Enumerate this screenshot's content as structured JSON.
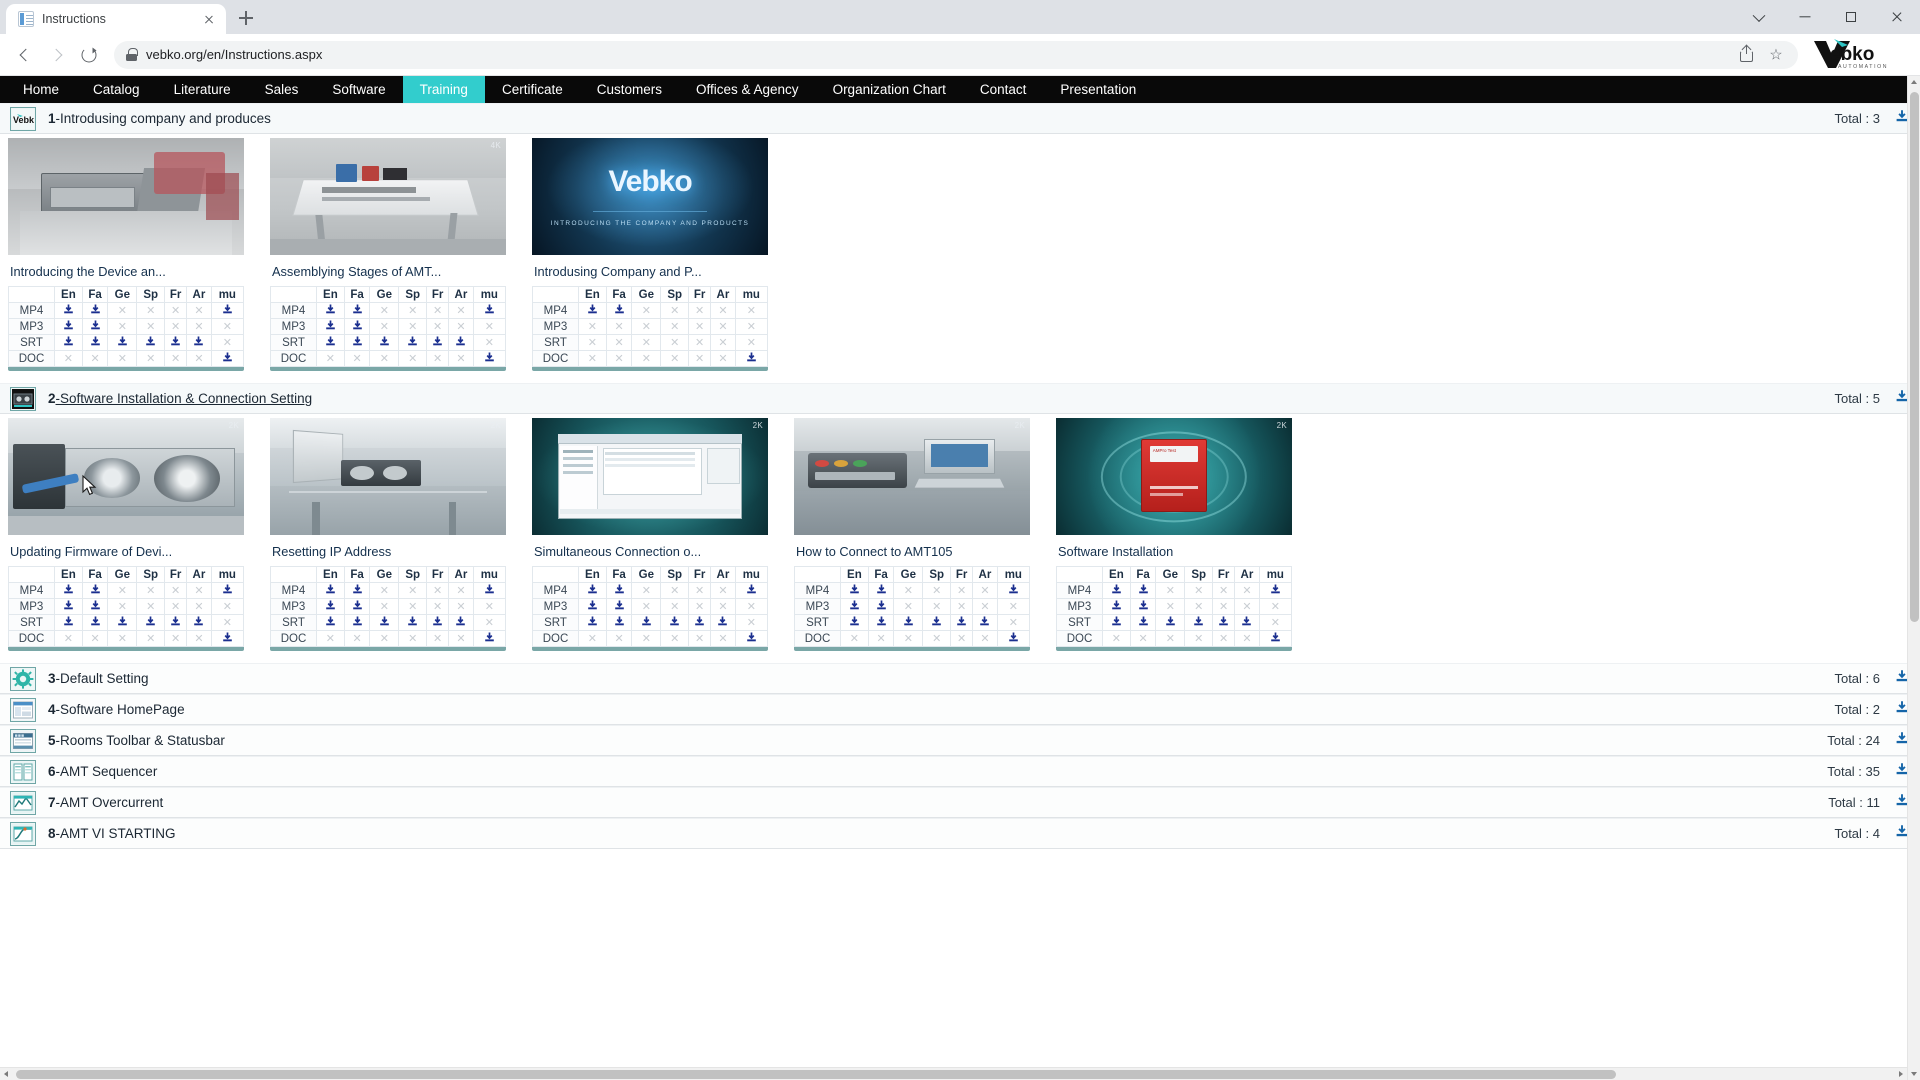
{
  "browser": {
    "tab_title": "Instructions",
    "url": "vebko.org/en/Instructions.aspx",
    "new_tab_label": "+",
    "logo_text": "Vebko",
    "logo_sub": "AUTOMATION"
  },
  "navbar": {
    "items": [
      {
        "label": "Home",
        "active": false
      },
      {
        "label": "Catalog",
        "active": false
      },
      {
        "label": "Literature",
        "active": false
      },
      {
        "label": "Sales",
        "active": false
      },
      {
        "label": "Software",
        "active": false
      },
      {
        "label": "Training",
        "active": true
      },
      {
        "label": "Certificate",
        "active": false
      },
      {
        "label": "Customers",
        "active": false
      },
      {
        "label": "Offices & Agency",
        "active": false
      },
      {
        "label": "Organization Chart",
        "active": false
      },
      {
        "label": "Contact",
        "active": false
      },
      {
        "label": "Presentation",
        "active": false
      }
    ],
    "accent_color": "#32CDCD",
    "background_color": "#090909"
  },
  "lang_columns": [
    "En",
    "Fa",
    "Ge",
    "Sp",
    "Fr",
    "Ar",
    "mu"
  ],
  "media_rows": [
    "MP4",
    "MP3",
    "SRT",
    "DOC"
  ],
  "sections": [
    {
      "number": "1",
      "title": "-Introdusing company and produces",
      "total_label": "Total : 3",
      "expanded": true,
      "link": false,
      "icon": "vebko-logo-icon",
      "cards": [
        {
          "title": "Introducing the Device an...",
          "thumb": "workbench-case",
          "badge": "",
          "matrix": {
            "MP4": [
              1,
              1,
              0,
              0,
              0,
              0,
              1
            ],
            "MP3": [
              1,
              1,
              0,
              0,
              0,
              0,
              0
            ],
            "SRT": [
              1,
              1,
              1,
              1,
              1,
              1,
              0
            ],
            "DOC": [
              0,
              0,
              0,
              0,
              0,
              0,
              1
            ]
          }
        },
        {
          "title": "Assemblying Stages of AMT...",
          "thumb": "assembly-table",
          "badge": "4K",
          "matrix": {
            "MP4": [
              1,
              1,
              0,
              0,
              0,
              0,
              1
            ],
            "MP3": [
              1,
              1,
              0,
              0,
              0,
              0,
              0
            ],
            "SRT": [
              1,
              1,
              1,
              1,
              1,
              1,
              0
            ],
            "DOC": [
              0,
              0,
              0,
              0,
              0,
              0,
              1
            ]
          }
        },
        {
          "title": "Introdusing Company and P...",
          "thumb": "vebko-intro-video",
          "badge": "",
          "matrix": {
            "MP4": [
              1,
              1,
              0,
              0,
              0,
              0,
              0
            ],
            "MP3": [
              0,
              0,
              0,
              0,
              0,
              0,
              0
            ],
            "SRT": [
              0,
              0,
              0,
              0,
              0,
              0,
              0
            ],
            "DOC": [
              0,
              0,
              0,
              0,
              0,
              0,
              1
            ]
          }
        }
      ]
    },
    {
      "number": "2",
      "title": "-Software Installation & Connection Setting",
      "total_label": "Total : 5",
      "expanded": true,
      "link": true,
      "icon": "device-rack-icon",
      "cards": [
        {
          "title": "Updating Firmware of Devi...",
          "thumb": "firmware-device",
          "badge": "2K",
          "matrix": {
            "MP4": [
              1,
              1,
              0,
              0,
              0,
              0,
              1
            ],
            "MP3": [
              1,
              1,
              0,
              0,
              0,
              0,
              0
            ],
            "SRT": [
              1,
              1,
              1,
              1,
              1,
              1,
              0
            ],
            "DOC": [
              0,
              0,
              0,
              0,
              0,
              0,
              1
            ]
          }
        },
        {
          "title": "Resetting IP Address",
          "thumb": "ip-reset-bench",
          "badge": "2K",
          "matrix": {
            "MP4": [
              1,
              1,
              0,
              0,
              0,
              0,
              1
            ],
            "MP3": [
              1,
              1,
              0,
              0,
              0,
              0,
              0
            ],
            "SRT": [
              1,
              1,
              1,
              1,
              1,
              1,
              0
            ],
            "DOC": [
              0,
              0,
              0,
              0,
              0,
              0,
              1
            ]
          }
        },
        {
          "title": "Simultaneous Connection o...",
          "thumb": "software-window",
          "badge": "2K",
          "matrix": {
            "MP4": [
              1,
              1,
              0,
              0,
              0,
              0,
              1
            ],
            "MP3": [
              1,
              1,
              0,
              0,
              0,
              0,
              0
            ],
            "SRT": [
              1,
              1,
              1,
              1,
              1,
              1,
              0
            ],
            "DOC": [
              0,
              0,
              0,
              0,
              0,
              0,
              1
            ]
          }
        },
        {
          "title": "How to Connect to AMT105",
          "thumb": "amt105-bench",
          "badge": "2K",
          "matrix": {
            "MP4": [
              1,
              1,
              0,
              0,
              0,
              0,
              1
            ],
            "MP3": [
              1,
              1,
              0,
              0,
              0,
              0,
              0
            ],
            "SRT": [
              1,
              1,
              1,
              1,
              1,
              1,
              0
            ],
            "DOC": [
              0,
              0,
              0,
              0,
              0,
              0,
              1
            ]
          }
        },
        {
          "title": "Software Installation",
          "thumb": "installer-box",
          "badge": "2K",
          "matrix": {
            "MP4": [
              1,
              1,
              0,
              0,
              0,
              0,
              1
            ],
            "MP3": [
              1,
              1,
              0,
              0,
              0,
              0,
              0
            ],
            "SRT": [
              1,
              1,
              1,
              1,
              1,
              1,
              0
            ],
            "DOC": [
              0,
              0,
              0,
              0,
              0,
              0,
              1
            ]
          }
        }
      ]
    },
    {
      "number": "3",
      "title": "-Default Setting",
      "total_label": "Total : 6",
      "expanded": false,
      "link": false,
      "icon": "gear-icon",
      "cards": []
    },
    {
      "number": "4",
      "title": "-Software HomePage",
      "total_label": "Total : 2",
      "expanded": false,
      "link": false,
      "icon": "software-home-icon",
      "cards": []
    },
    {
      "number": "5",
      "title": "-Rooms Toolbar & Statusbar",
      "total_label": "Total : 24",
      "expanded": false,
      "link": false,
      "icon": "toolbar-icon",
      "cards": []
    },
    {
      "number": "6",
      "title": "-AMT Sequencer",
      "total_label": "Total : 35",
      "expanded": false,
      "link": false,
      "icon": "sequencer-icon",
      "cards": []
    },
    {
      "number": "7",
      "title": "-AMT Overcurrent",
      "total_label": "Total : 11",
      "expanded": false,
      "link": false,
      "icon": "overcurrent-icon",
      "cards": []
    },
    {
      "number": "8",
      "title": "-AMT VI STARTING",
      "total_label": "Total : 4",
      "expanded": false,
      "link": false,
      "icon": "vi-starting-icon",
      "cards": []
    }
  ]
}
